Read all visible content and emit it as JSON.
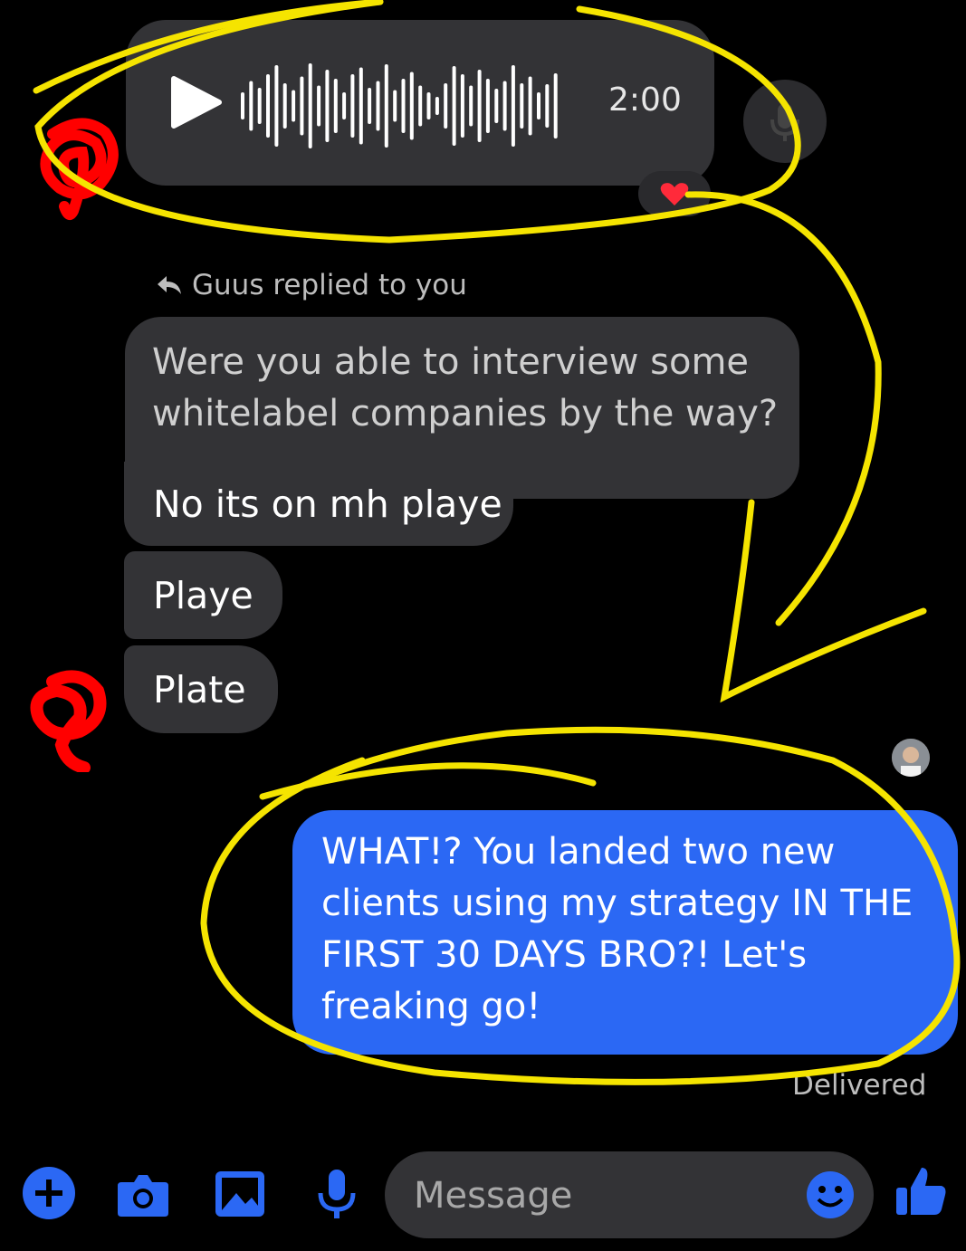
{
  "voice_message": {
    "duration": "2:00"
  },
  "reply_header": "Guus replied to you",
  "quoted_message": "Were you able to interview some whitelabel companies by the way?",
  "received_messages": [
    "No its on mh playe",
    "Playe",
    "Plate"
  ],
  "sent_message": "WHAT!? You landed two new clients using my strategy IN THE FIRST 30 DAYS BRO?! Let's freaking go!",
  "status": "Delivered",
  "composer": {
    "placeholder": "Message"
  },
  "colors": {
    "accent": "#2b68f4",
    "bubble": "#333336",
    "annotation": "#f5e400",
    "scribble": "#ff0000"
  },
  "icons": [
    "play-icon",
    "microphone-icon",
    "heart-icon",
    "reply-icon",
    "plus-icon",
    "camera-icon",
    "image-icon",
    "emoji-icon",
    "thumbs-up-icon"
  ]
}
